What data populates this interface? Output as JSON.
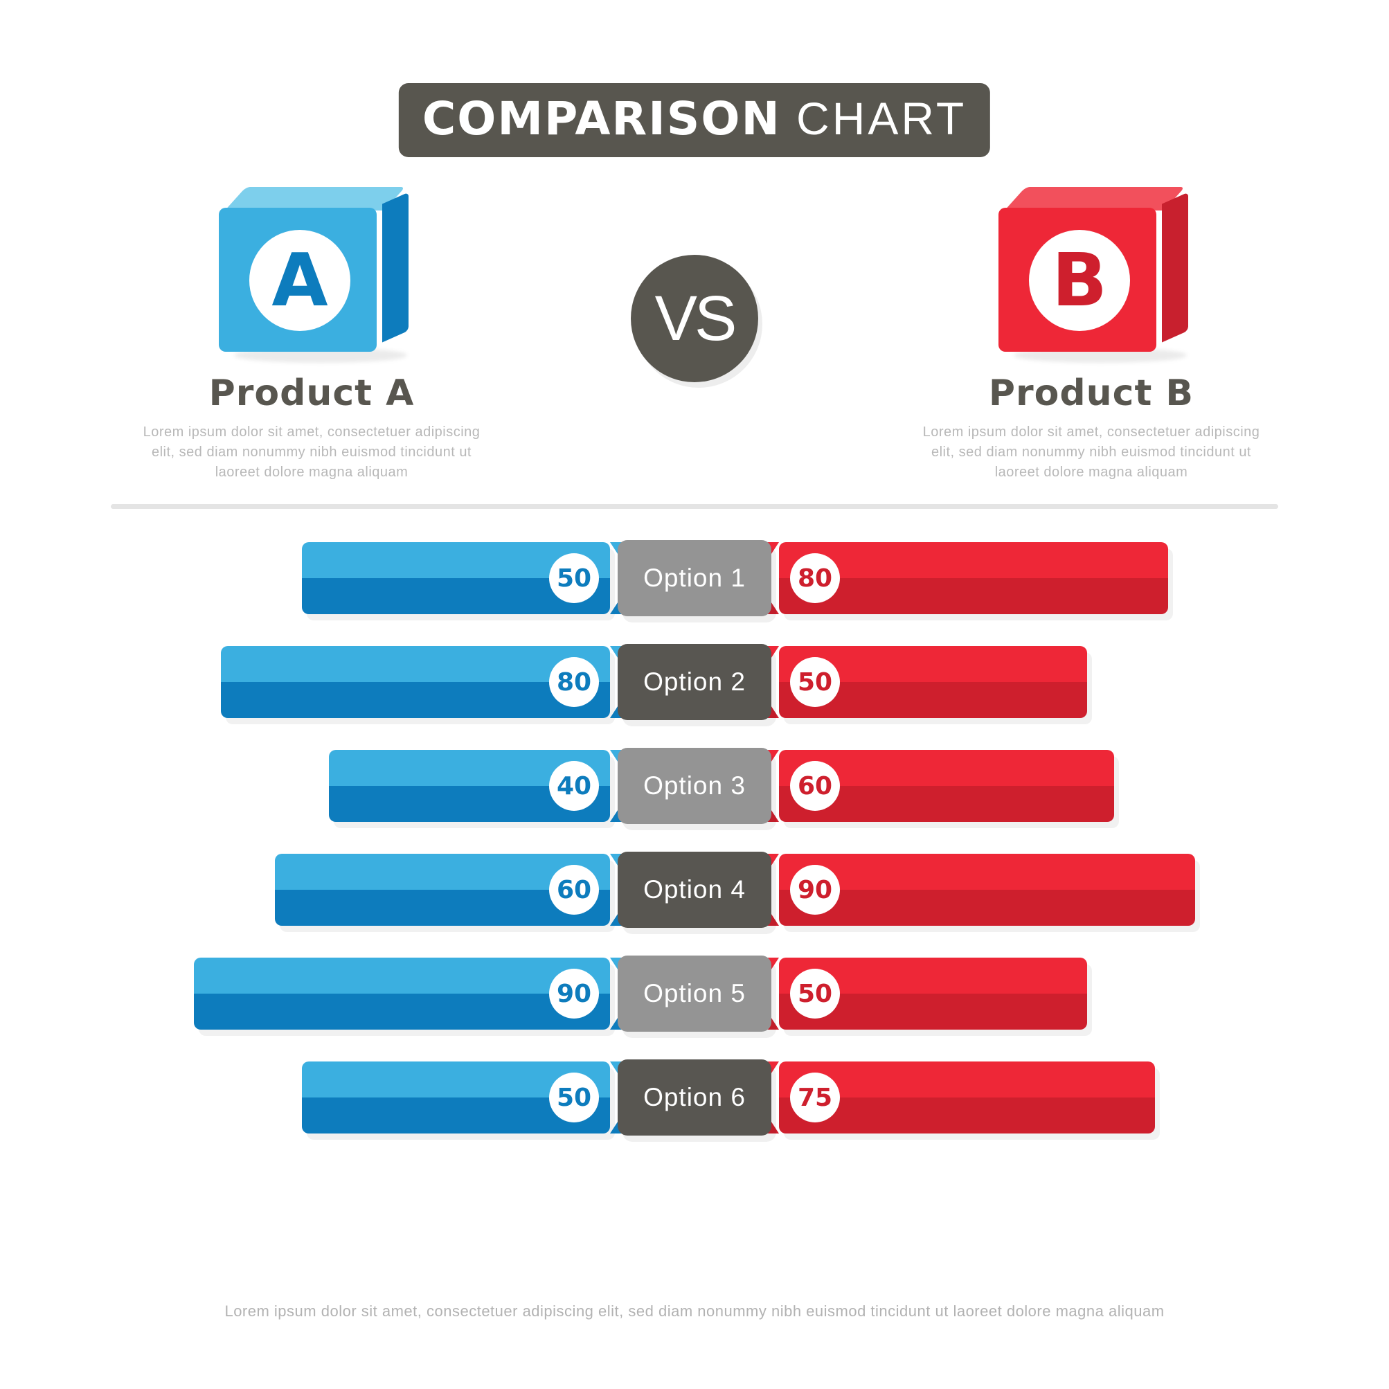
{
  "title": {
    "strong": "COMPARISON",
    "light": "CHART"
  },
  "vs": {
    "label": "VS"
  },
  "products": {
    "a": {
      "letter": "A",
      "name": "Product A",
      "description": "Lorem ipsum dolor sit amet, consectetuer adipiscing elit, sed diam nonummy nibh euismod tincidunt ut laoreet dolore magna aliquam",
      "color_front": "#3BAFE0",
      "color_top": "#7DCFEC",
      "color_side": "#0D7CBD",
      "color_letter": "#0D7CBD"
    },
    "b": {
      "letter": "B",
      "name": "Product B",
      "description": "Lorem ipsum dolor sit amet, consectetuer adipiscing elit, sed diam nonummy nibh euismod tincidunt ut laoreet dolore magna aliquam",
      "color_front": "#EE2737",
      "color_top": "#F2505C",
      "color_side": "#C8202E",
      "color_letter": "#CE1F2D"
    }
  },
  "footer": {
    "text": "Lorem ipsum dolor sit amet, consectetuer adipiscing elit, sed diam nonummy nibh euismod tincidunt ut laoreet dolore magna aliquam"
  },
  "chart_data": {
    "type": "bar",
    "title": "COMPARISON CHART",
    "orientation": "horizontal-diverging",
    "categories": [
      "Option 1",
      "Option 2",
      "Option 3",
      "Option 4",
      "Option 5",
      "Option 6"
    ],
    "series": [
      {
        "name": "Product A",
        "values": [
          50,
          80,
          40,
          60,
          90,
          50
        ],
        "color": "#3BAFE0",
        "side": "left"
      },
      {
        "name": "Product B",
        "values": [
          80,
          50,
          60,
          90,
          50,
          75
        ],
        "color": "#EE2737",
        "side": "right"
      }
    ],
    "xlabel": "",
    "ylabel": "",
    "xlim": [
      0,
      100
    ],
    "grid": false,
    "legend": "none",
    "pill_colors": [
      "#949494",
      "#585651",
      "#949494",
      "#585651",
      "#949494",
      "#585651"
    ]
  }
}
